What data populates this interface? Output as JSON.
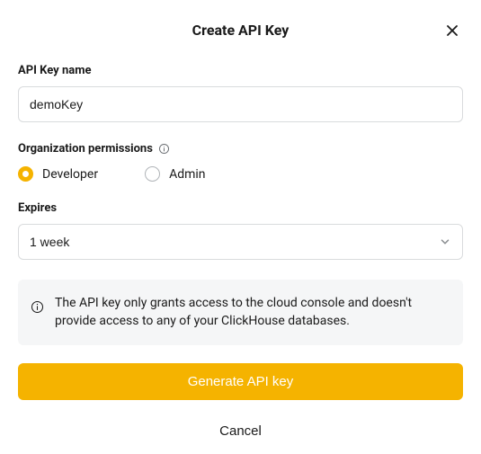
{
  "header": {
    "title": "Create API Key"
  },
  "name_field": {
    "label": "API Key name",
    "value": "demoKey"
  },
  "permissions": {
    "label": "Organization permissions",
    "options": [
      {
        "label": "Developer",
        "selected": true
      },
      {
        "label": "Admin",
        "selected": false
      }
    ]
  },
  "expires": {
    "label": "Expires",
    "selected": "1 week"
  },
  "notice": {
    "text": "The API key only grants access to the cloud console and doesn't provide access to any of your ClickHouse databases."
  },
  "actions": {
    "primary": "Generate API key",
    "cancel": "Cancel"
  }
}
